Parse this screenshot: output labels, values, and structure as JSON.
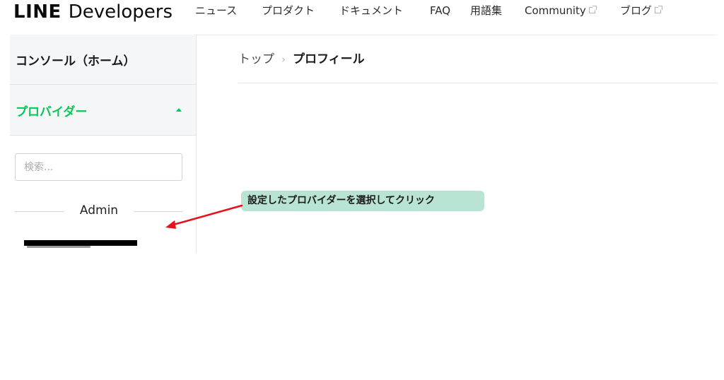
{
  "header": {
    "brand_bold": "LINE",
    "brand_rest": "Developers",
    "nav": [
      {
        "label": "ニュース",
        "external": false
      },
      {
        "label": "プロダクト",
        "external": false
      },
      {
        "label": "ドキュメント",
        "external": false
      },
      {
        "label": "FAQ",
        "external": false
      },
      {
        "label": "用語集",
        "external": false
      },
      {
        "label": "Community",
        "external": true
      },
      {
        "label": "ブログ",
        "external": true
      }
    ],
    "external_icon": "external-link-icon"
  },
  "sidebar": {
    "home_label": "コンソール（ホーム）",
    "provider_label": "プロバイダー",
    "provider_expanded": true,
    "provider_icon": "caret-up-icon",
    "search_placeholder": "検索...",
    "search_value": "",
    "group_label": "Admin",
    "items": [
      {
        "label_redacted": true
      }
    ]
  },
  "main": {
    "breadcrumb": {
      "top": "トップ",
      "separator": "›",
      "current": "プロフィール"
    }
  },
  "annotation": {
    "text": "設定したプロバイダーを選択してクリック",
    "arrow_icon": "red-arrow-icon"
  },
  "colors": {
    "accent_green": "#06c755",
    "annotation_bg": "#b9e4d4",
    "arrow_red": "#e8101a",
    "sidebar_bg": "#f5f6f7"
  }
}
